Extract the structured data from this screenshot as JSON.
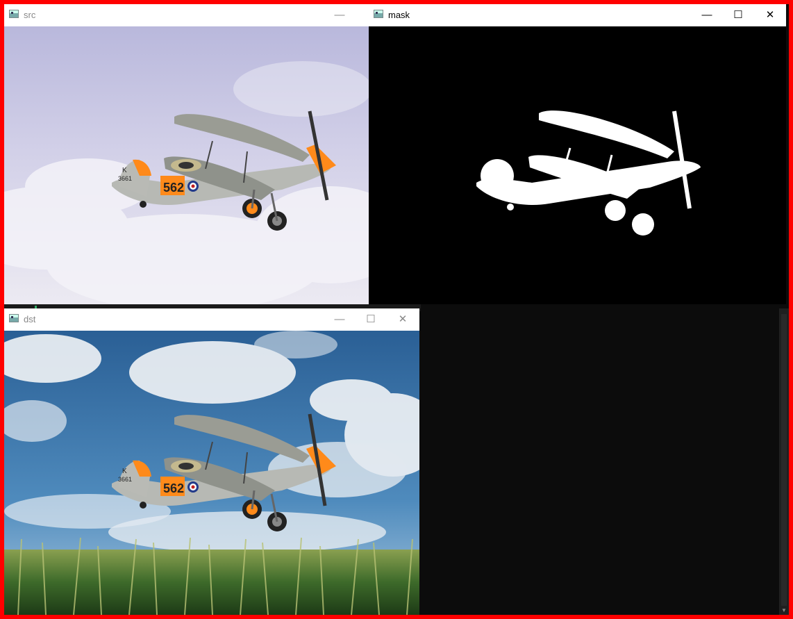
{
  "windows": {
    "src": {
      "title": "src"
    },
    "mask": {
      "title": "mask"
    },
    "dst": {
      "title": "dst"
    }
  },
  "plane": {
    "fuselage_number": "562",
    "tail_letter": "K",
    "tail_serial": "3661"
  },
  "controls": {
    "minimize": "—",
    "maximize": "☐",
    "close": "✕"
  },
  "colors": {
    "frame_border": "#ff0000",
    "mask_background": "#000000",
    "mask_foreground": "#ffffff",
    "console_background": "#0c0c0c",
    "plane_orange": "#ff8a1a",
    "sky_blue": "#2f6fa7"
  }
}
